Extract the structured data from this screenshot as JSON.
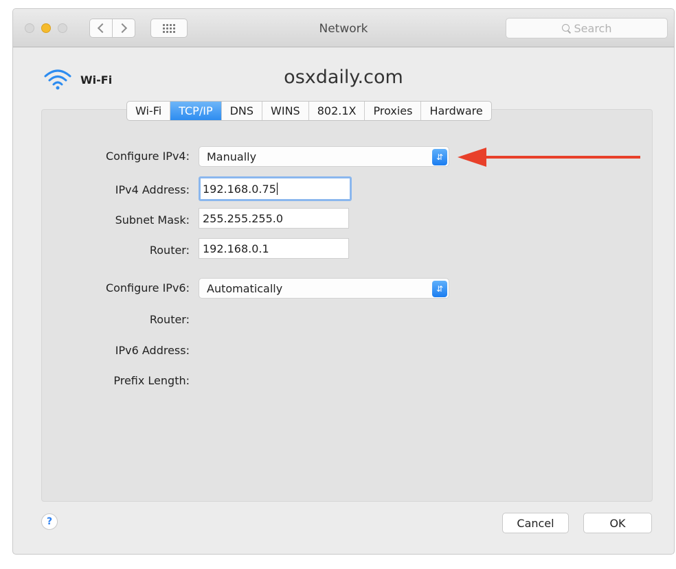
{
  "window": {
    "title": "Network",
    "search_placeholder": "Search",
    "icons": [
      "back-icon",
      "forward-icon",
      "grid-icon",
      "search-icon"
    ]
  },
  "service": {
    "name": "Wi-Fi",
    "icon": "wifi-icon",
    "location": "osxdaily.com"
  },
  "tabs": [
    {
      "label": "Wi-Fi",
      "active": false
    },
    {
      "label": "TCP/IP",
      "active": true
    },
    {
      "label": "DNS",
      "active": false
    },
    {
      "label": "WINS",
      "active": false
    },
    {
      "label": "802.1X",
      "active": false
    },
    {
      "label": "Proxies",
      "active": false
    },
    {
      "label": "Hardware",
      "active": false
    }
  ],
  "ipv4": {
    "configure_label": "Configure IPv4:",
    "configure_value": "Manually",
    "address_label": "IPv4 Address:",
    "address_value": "192.168.0.75",
    "subnet_label": "Subnet Mask:",
    "subnet_value": "255.255.255.0",
    "router_label": "Router:",
    "router_value": "192.168.0.1"
  },
  "ipv6": {
    "configure_label": "Configure IPv6:",
    "configure_value": "Automatically",
    "router_label": "Router:",
    "address_label": "IPv6 Address:",
    "prefix_label": "Prefix Length:"
  },
  "footer": {
    "help_label": "?",
    "cancel_label": "Cancel",
    "ok_label": "OK"
  },
  "colors": {
    "accent": "#2d8cf0",
    "annotation_arrow": "#e8402a",
    "window_bg": "#ececec"
  }
}
